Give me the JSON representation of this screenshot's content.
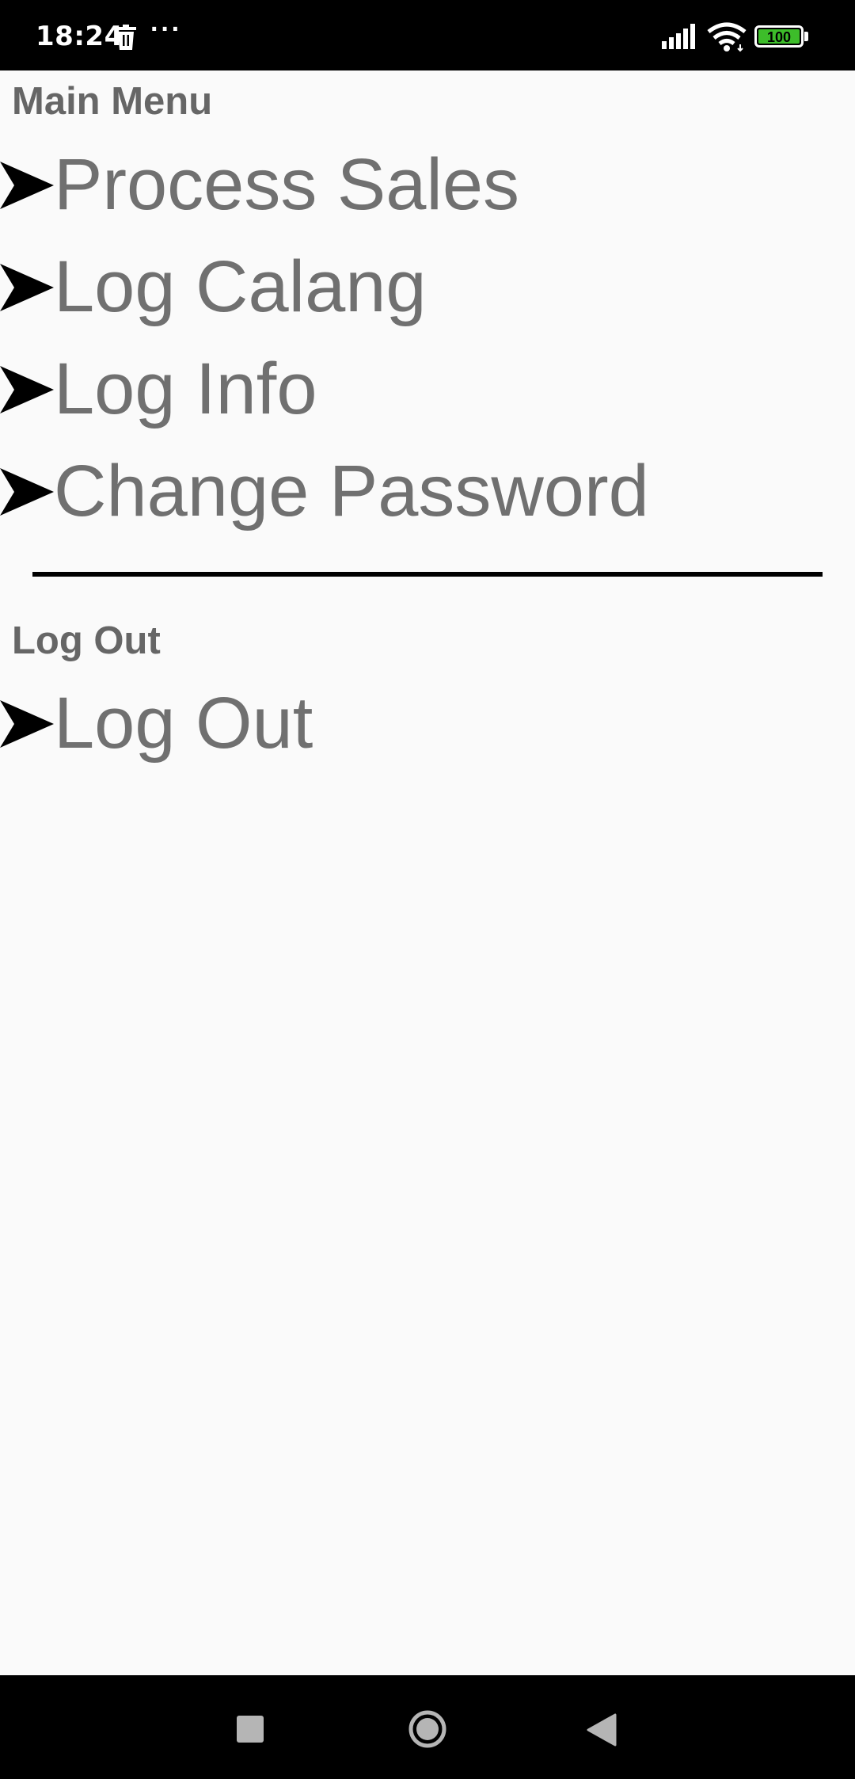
{
  "status_bar": {
    "time": "18:24",
    "overflow": "···",
    "battery_level": "100",
    "icons": [
      "trash-icon",
      "signal-icon",
      "wifi-icon",
      "battery-icon"
    ]
  },
  "main_menu": {
    "header": "Main Menu",
    "items": [
      {
        "label": "Process Sales",
        "icon": "arrow-right-icon"
      },
      {
        "label": "Log Calang",
        "icon": "arrow-right-icon"
      },
      {
        "label": "Log Info",
        "icon": "arrow-right-icon"
      },
      {
        "label": "Change Password",
        "icon": "arrow-right-icon"
      }
    ]
  },
  "logout_section": {
    "header": "Log Out",
    "items": [
      {
        "label": "Log Out",
        "icon": "arrow-right-icon"
      }
    ]
  },
  "nav_bar": {
    "icons": [
      "recents-square-icon",
      "home-circle-icon",
      "back-triangle-icon"
    ]
  },
  "colors": {
    "background": "#fafafa",
    "text": "#707070",
    "header": "#666666",
    "bars": "#000000",
    "battery": "#3dbd2a"
  }
}
